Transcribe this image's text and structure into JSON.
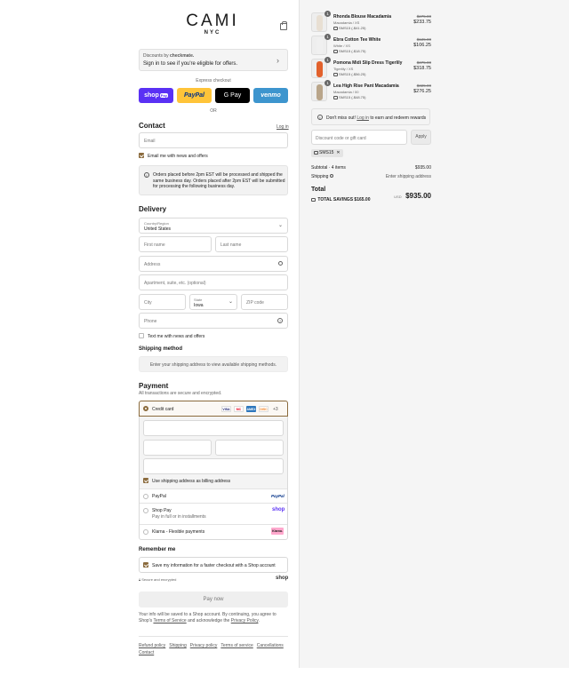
{
  "brand": {
    "name": "CAMI",
    "sub": "NYC"
  },
  "discounts_box": {
    "by_prefix": "Discounts by",
    "by_brand": "checkmate.",
    "text": "Sign in to see if you're eligible for offers."
  },
  "express": {
    "label": "Express checkout",
    "or": "OR",
    "buttons": {
      "shop": "shop",
      "paypal": "PayPal",
      "gpay": "G Pay",
      "venmo": "venmo"
    }
  },
  "contact": {
    "heading": "Contact",
    "login": "Log in",
    "email_placeholder": "Email",
    "news_label": "Email me with news and offers",
    "notice": "Orders placed before 2pm EST will be processed and shipped the same business day. Orders placed after 2pm EST will be submitted for processing the following business day."
  },
  "delivery": {
    "heading": "Delivery",
    "country_label": "Country/Region",
    "country_value": "United States",
    "first_name": "First name",
    "last_name": "Last name",
    "address": "Address",
    "apartment": "Apartment, suite, etc. (optional)",
    "city": "City",
    "state_label": "State",
    "state_value": "Iowa",
    "zip": "ZIP code",
    "phone": "Phone",
    "text_news": "Text me with news and offers"
  },
  "shipping": {
    "heading": "Shipping method",
    "note": "Enter your shipping address to view available shipping methods."
  },
  "payment": {
    "heading": "Payment",
    "sub": "All transactions are secure and encrypted.",
    "credit_card": "Credit card",
    "more": "+3",
    "card_brands": [
      "VISA",
      "MC",
      "AMEX",
      "DISC"
    ],
    "billing_label": "Use shipping address as billing address",
    "paypal": "PayPal",
    "paypal_logo": "PayPal",
    "shop_pay": "Shop Pay",
    "shop_pay_sub": "Pay in full or in installments",
    "shop_logo": "shop",
    "klarna": "Klarna - Flexible payments",
    "klarna_logo": "Klarna."
  },
  "remember": {
    "heading": "Remember me",
    "label": "Save my information for a faster checkout with a Shop account",
    "secure": "Secure and encrypted",
    "shop": "shop"
  },
  "pay_now": "Pay now",
  "legal": {
    "text1": "Your info will be saved to a Shop account. By continuing, you agree to Shop's",
    "tos": "Terms of Service",
    "text2": "and acknowledge the",
    "privacy": "Privacy Policy",
    "text3": "."
  },
  "footer": {
    "links": [
      "Refund policy",
      "Shipping",
      "Privacy policy",
      "Terms of service",
      "Cancellations"
    ],
    "contact": "Contact"
  },
  "cart": {
    "items": [
      {
        "qty": "1",
        "name": "Rhonda Blouse Macadamia",
        "variant": "Macadamia / XS",
        "discount": "SMS15 (-$41.25)",
        "old": "$275.00",
        "price": "$233.75",
        "img": "#e8dfd3"
      },
      {
        "qty": "1",
        "name": "Ebra Cotton Tee White",
        "variant": "White / XS",
        "discount": "SMS15 (-$18.75)",
        "old": "$125.00",
        "price": "$106.25",
        "img": "#f0f0f0"
      },
      {
        "qty": "1",
        "name": "Pomona Midi Slip Dress Tigerlily",
        "variant": "Tigerlily / XS",
        "discount": "SMS15 (-$56.25)",
        "old": "$375.00",
        "price": "$318.75",
        "img": "#e2612c"
      },
      {
        "qty": "1",
        "name": "Lea High Rise Pant Macadamia",
        "variant": "Macadamia / 00",
        "discount": "SMS15 (-$48.75)",
        "old": "$325.00",
        "price": "$276.25",
        "img": "#b9a58a"
      }
    ],
    "rewards_prefix": "Don't miss out!",
    "rewards_link": "Log in",
    "rewards_suffix": "to earn and redeem rewards",
    "discount_placeholder": "Discount code or gift card",
    "apply": "Apply",
    "code": "SMS15",
    "subtotal_label": "Subtotal · 4 items",
    "subtotal": "$935.00",
    "shipping_label": "Shipping",
    "shipping_value": "Enter shipping address",
    "total_label": "Total",
    "currency": "USD",
    "total": "$935.00",
    "savings_label": "TOTAL SAVINGS",
    "savings": "$165.00"
  }
}
